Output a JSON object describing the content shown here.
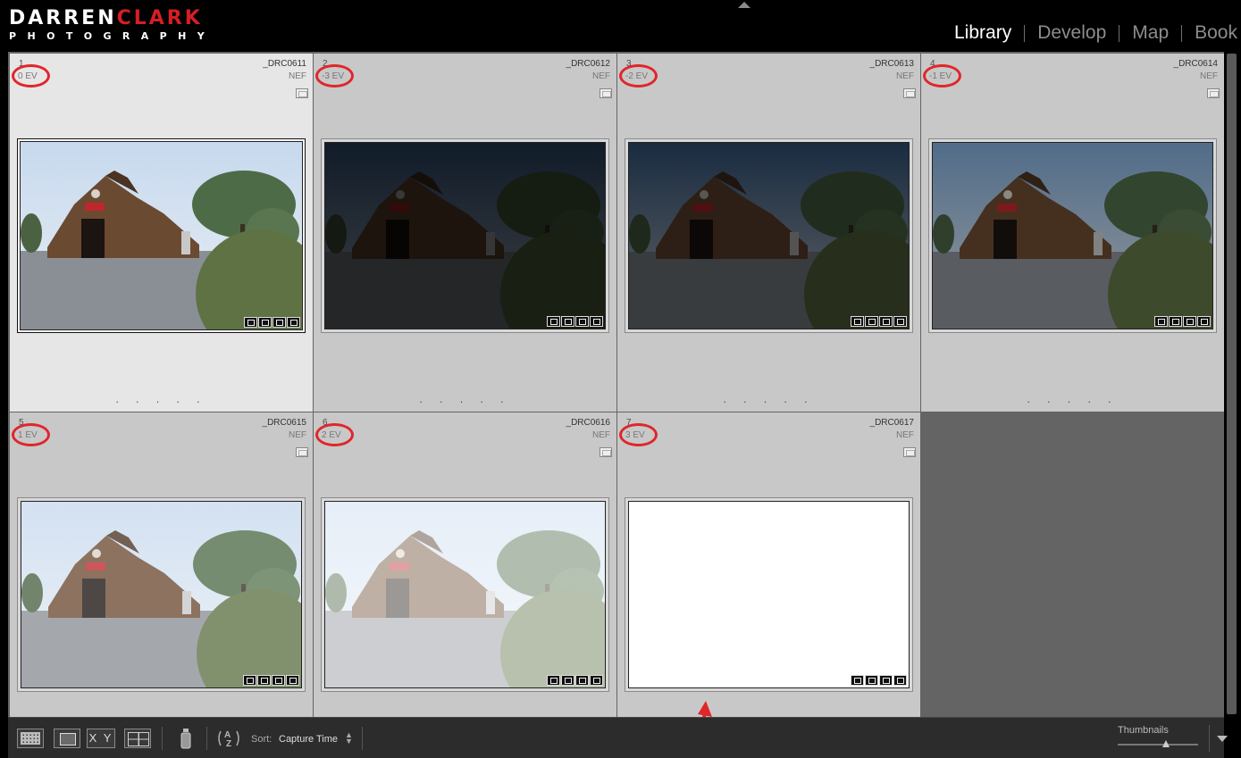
{
  "logo": {
    "word1": "DARREN",
    "word2": "CLARK",
    "tagline": "PHOTOGRAPHY"
  },
  "modules": [
    {
      "label": "Library",
      "active": true
    },
    {
      "label": "Develop",
      "active": false
    },
    {
      "label": "Map",
      "active": false
    },
    {
      "label": "Book",
      "active": false
    }
  ],
  "grid": {
    "cells": [
      {
        "index": "1",
        "filename": "_DRC0611",
        "ev": "0 EV",
        "ext": "NEF",
        "selected": true,
        "exposure": 0
      },
      {
        "index": "2",
        "filename": "_DRC0612",
        "ev": "-3 EV",
        "ext": "NEF",
        "selected": false,
        "exposure": -3
      },
      {
        "index": "3",
        "filename": "_DRC0613",
        "ev": "-2 EV",
        "ext": "NEF",
        "selected": false,
        "exposure": -2
      },
      {
        "index": "4",
        "filename": "_DRC0614",
        "ev": "-1 EV",
        "ext": "NEF",
        "selected": false,
        "exposure": -1
      },
      {
        "index": "5",
        "filename": "_DRC0615",
        "ev": "1 EV",
        "ext": "NEF",
        "selected": false,
        "exposure": 1
      },
      {
        "index": "6",
        "filename": "_DRC0616",
        "ev": "2 EV",
        "ext": "NEF",
        "selected": false,
        "exposure": 2
      },
      {
        "index": "7",
        "filename": "_DRC0617",
        "ev": "3 EV",
        "ext": "NEF",
        "selected": false,
        "exposure": 3
      }
    ],
    "dots": ". . . . ."
  },
  "annotations": {
    "circle_color": "#e0262a",
    "arrow_color": "#e0262a"
  },
  "toolbar": {
    "compare_label": "X Y",
    "sort_label": "Sort:",
    "sort_value": "Capture Time",
    "thumbnails_label": "Thumbnails",
    "thumbnail_size_fraction": 0.6
  },
  "icons": {
    "grid_view": "grid-view-icon",
    "loupe_view": "loupe-view-icon",
    "compare_view": "compare-view-icon",
    "survey_view": "survey-view-icon",
    "painter": "painter-icon",
    "sort_direction": "sort-direction-icon"
  }
}
